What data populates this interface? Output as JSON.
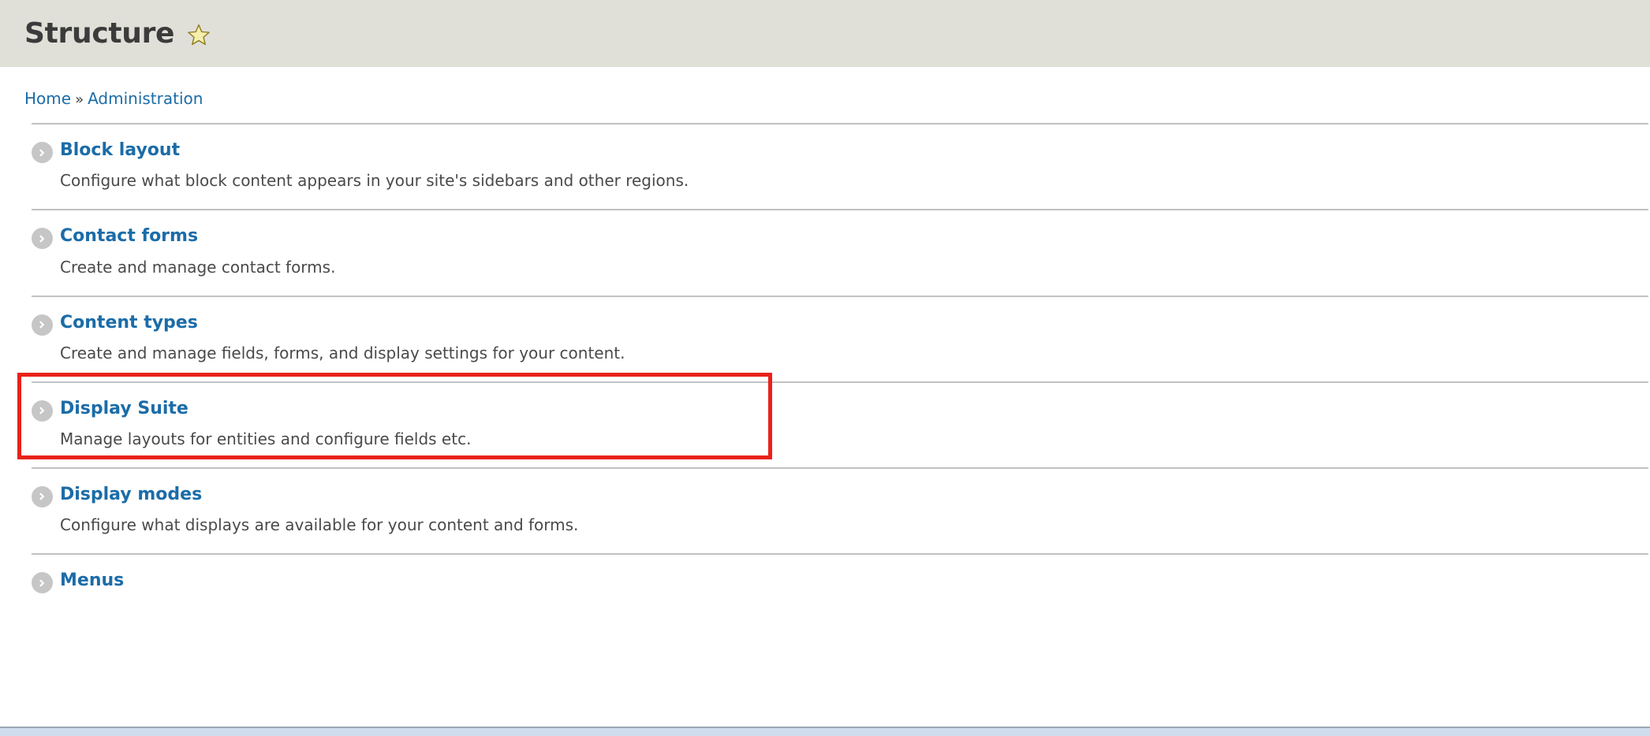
{
  "header": {
    "title": "Structure",
    "star_icon": "star-icon",
    "background_color": "#e0e0d9",
    "title_color": "#3b3b3b",
    "star_fill": "#f5eeac",
    "star_stroke": "#8a7a1e"
  },
  "breadcrumb": {
    "items": [
      {
        "label": "Home"
      },
      {
        "label": "Administration"
      }
    ],
    "separator": "»",
    "link_color": "#1b6ca8"
  },
  "annotation": {
    "color": "#e8231a",
    "target": "Content types"
  },
  "admin_list": {
    "items": [
      {
        "title": "Block layout",
        "description": "Configure what block content appears in your site's sidebars and other regions.",
        "icon": "chevron-right-circle-icon",
        "highlighted": false
      },
      {
        "title": "Contact forms",
        "description": "Create and manage contact forms.",
        "icon": "chevron-right-circle-icon",
        "highlighted": false
      },
      {
        "title": "Content types",
        "description": "Create and manage fields, forms, and display settings for your content.",
        "icon": "chevron-right-circle-icon",
        "highlighted": true
      },
      {
        "title": "Display Suite",
        "description": "Manage layouts for entities and configure fields etc.",
        "icon": "chevron-right-circle-icon",
        "highlighted": false
      },
      {
        "title": "Display modes",
        "description": "Configure what displays are available for your content and forms.",
        "icon": "chevron-right-circle-icon",
        "highlighted": false
      },
      {
        "title": "Menus",
        "description": "",
        "icon": "chevron-right-circle-icon",
        "highlighted": false
      }
    ]
  }
}
